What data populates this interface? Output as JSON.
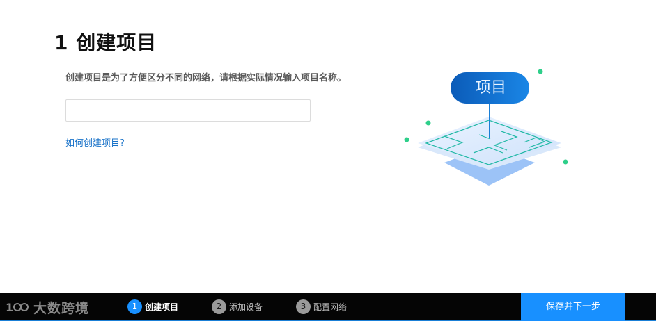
{
  "page": {
    "title": "1 创建项目",
    "description": "创建项目是为了方便区分不同的网络，请根据实际情况输入项目名称。",
    "project_name_input": {
      "value": "",
      "placeholder": ""
    },
    "help_link": "如何创建项目?"
  },
  "illustration": {
    "label": "项目",
    "icon": "project-map-icon"
  },
  "footer": {
    "logo_text": "大数跨境",
    "steps": [
      {
        "number": "1",
        "label": "创建项目",
        "active": true
      },
      {
        "number": "2",
        "label": "添加设备",
        "active": false
      },
      {
        "number": "3",
        "label": "配置网络",
        "active": false
      }
    ],
    "primary_button": "保存并下一步"
  },
  "colors": {
    "accent": "#1890ff",
    "link": "#1a73c9",
    "footer_bg": "#050505",
    "dot_green": "#2ecf8a"
  }
}
